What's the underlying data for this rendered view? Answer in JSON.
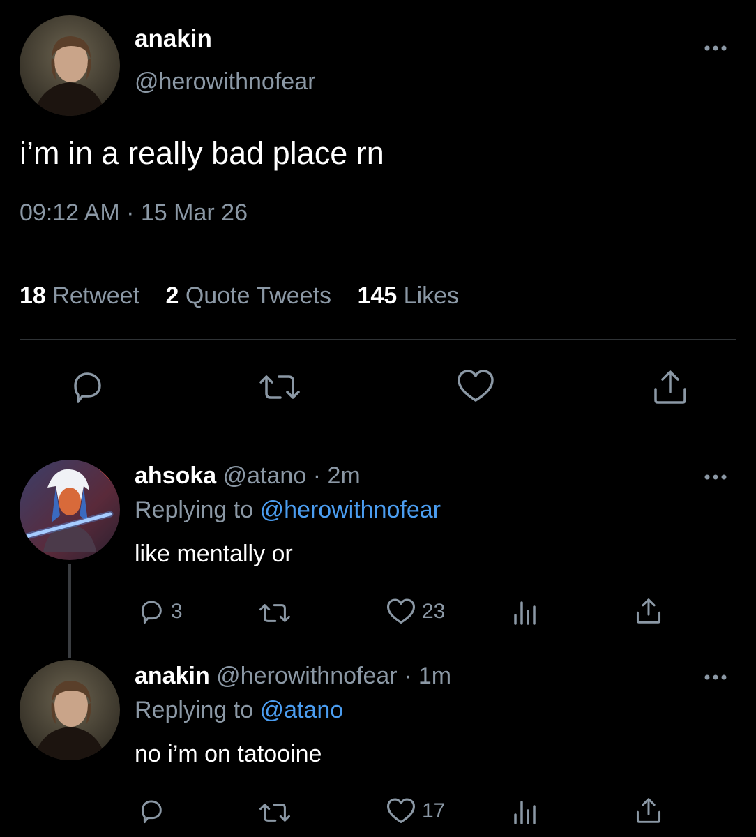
{
  "main_tweet": {
    "display_name": "anakin",
    "handle": "@herowithnofear",
    "text": "i’m in a really bad place rn",
    "time": "09:12 AM",
    "separator": "·",
    "date": "15 Mar 26",
    "stats": {
      "retweets_count": "18",
      "retweets_label": "Retweet",
      "quotes_count": "2",
      "quotes_label": "Quote Tweets",
      "likes_count": "145",
      "likes_label": "Likes"
    },
    "icons": [
      "reply-icon",
      "retweet-icon",
      "like-icon",
      "share-icon",
      "more-icon"
    ]
  },
  "replies": [
    {
      "display_name": "ahsoka",
      "handle": "@atano",
      "separator": "·",
      "age": "2m",
      "replying_label": "Replying to",
      "replying_to": "@herowithnofear",
      "text": "like mentally or",
      "reply_count": "3",
      "retweet_count": "",
      "like_count": "23",
      "icons": [
        "reply-icon",
        "retweet-icon",
        "like-icon",
        "analytics-icon",
        "share-icon",
        "more-icon"
      ]
    },
    {
      "display_name": "anakin",
      "handle": "@herowithnofear",
      "separator": "·",
      "age": "1m",
      "replying_label": "Replying to",
      "replying_to": "@atano",
      "text": "no i’m on tatooine",
      "reply_count": "",
      "retweet_count": "",
      "like_count": "17",
      "icons": [
        "reply-icon",
        "retweet-icon",
        "like-icon",
        "analytics-icon",
        "share-icon",
        "more-icon"
      ]
    }
  ],
  "colors": {
    "background": "#000000",
    "text": "#ffffff",
    "muted": "#8b98a5",
    "link": "#4b9df0",
    "divider": "#2f3336"
  }
}
